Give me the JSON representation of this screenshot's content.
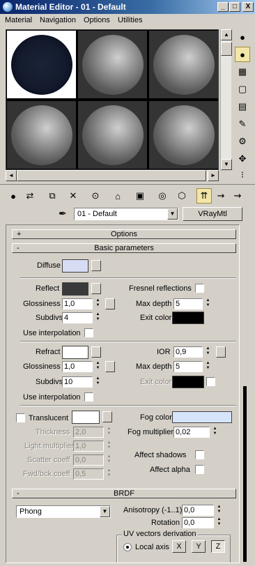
{
  "window": {
    "title": "Material Editor - 01 - Default",
    "minimize": "_",
    "maximize": "□",
    "close": "X"
  },
  "menu": [
    "Material",
    "Navigation",
    "Options",
    "Utilities"
  ],
  "slots_scroll": {
    "up": "▲",
    "down": "▼",
    "left": "◄",
    "right": "►"
  },
  "material": {
    "name": "01 - Default",
    "type": "VRayMtl"
  },
  "rollouts": {
    "options": {
      "sign": "+",
      "title": "Options"
    },
    "basic": {
      "sign": "-",
      "title": "Basic parameters"
    },
    "brdf": {
      "sign": "-",
      "title": "BRDF"
    }
  },
  "basic": {
    "diffuse_label": "Diffuse",
    "reflect_label": "Reflect",
    "fresnel_label": "Fresnel reflections",
    "glossiness_label": "Glossiness",
    "reflect_glossiness": "1,0",
    "max_depth_label": "Max depth",
    "reflect_max_depth": "5",
    "subdivs_label": "Subdivs",
    "reflect_subdivs": "4",
    "exit_color_label": "Exit color",
    "use_interp_label": "Use interpolation",
    "refract_label": "Refract",
    "ior_label": "IOR",
    "ior_value": "0,9",
    "refract_glossiness": "1,0",
    "refract_max_depth": "5",
    "refract_subdivs": "10",
    "refract_exit_color_label": "Exit color",
    "translucent_label": "Translucent",
    "fog_color_label": "Fog color",
    "thickness_label": "Thickness",
    "thickness_value": "2,0",
    "fog_mult_label": "Fog multiplier",
    "fog_mult_value": "0,02",
    "light_mult_label": "Light multiplier",
    "light_mult_value": "1,0",
    "scatter_label": "Scatter coeff",
    "scatter_value": "0,0",
    "fwd_label": "Fwd/bck coeff",
    "fwd_value": "0,5",
    "affect_shadows_label": "Affect shadows",
    "affect_alpha_label": "Affect alpha"
  },
  "brdf": {
    "type": "Phong",
    "anisotropy_label": "Anisotropy (-1..1)",
    "anisotropy_value": "0,0",
    "rotation_label": "Rotation",
    "rotation_value": "0,0",
    "uv_group_label": "UV vectors derivation",
    "local_axis_label": "Local axis",
    "axis_x": "X",
    "axis_y": "Y",
    "axis_z": "Z"
  },
  "colors": {
    "diffuse": "#d6dcf4",
    "reflect": "#3a3a3a",
    "reflect_exit": "#000000",
    "refract": "#ffffff",
    "refract_exit": "#000000",
    "translucent": "#ffffff",
    "fog": "#d6e4fa",
    "title_start": "#0a246a",
    "ui_face": "#d4d0c8"
  }
}
